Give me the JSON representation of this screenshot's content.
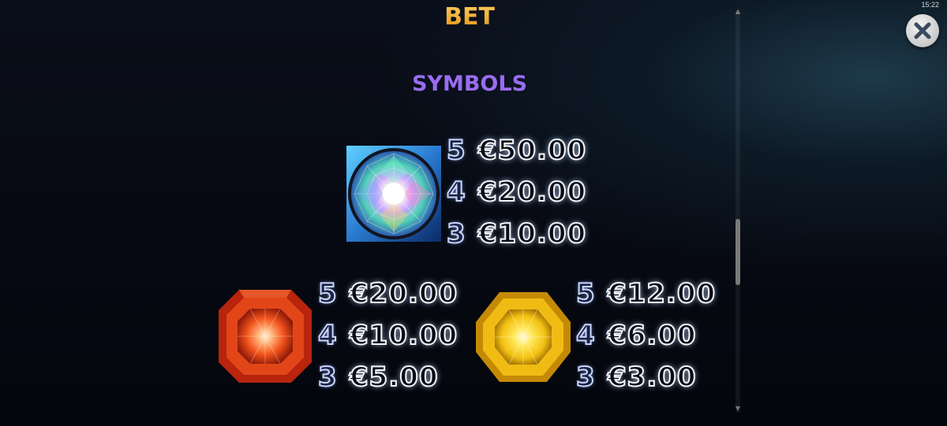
{
  "status": {
    "clock": "15:22"
  },
  "header": {
    "section_label": "BET"
  },
  "close_button": {
    "icon": "close-icon"
  },
  "symbols_section": {
    "title": "SYMBOLS",
    "symbols": [
      {
        "name": "rainbow-diamond",
        "icon": "rainbow-diamond-icon",
        "payouts": [
          {
            "count": "5",
            "prize": "€50.00"
          },
          {
            "count": "4",
            "prize": "€20.00"
          },
          {
            "count": "3",
            "prize": "€10.00"
          }
        ]
      },
      {
        "name": "red-gem",
        "icon": "red-gem-icon",
        "payouts": [
          {
            "count": "5",
            "prize": "€20.00"
          },
          {
            "count": "4",
            "prize": "€10.00"
          },
          {
            "count": "3",
            "prize": "€5.00"
          }
        ]
      },
      {
        "name": "yellow-gem",
        "icon": "yellow-gem-icon",
        "payouts": [
          {
            "count": "5",
            "prize": "€12.00"
          },
          {
            "count": "4",
            "prize": "€6.00"
          },
          {
            "count": "3",
            "prize": "€3.00"
          }
        ]
      }
    ]
  },
  "colors": {
    "heading": "#9a6cf0",
    "bet_label": "#f0a42a",
    "red_gem": "#e8401c",
    "yellow_gem": "#f6c81a"
  }
}
